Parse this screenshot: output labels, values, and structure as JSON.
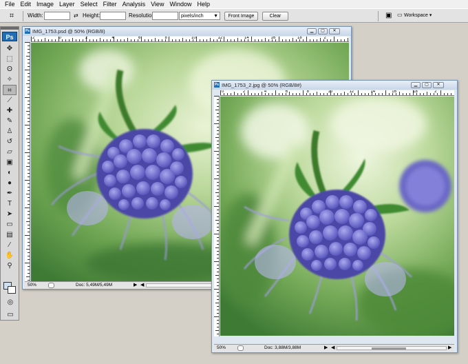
{
  "menu": [
    "File",
    "Edit",
    "Image",
    "Layer",
    "Select",
    "Filter",
    "Analysis",
    "View",
    "Window",
    "Help"
  ],
  "options_bar": {
    "width_label": "Width:",
    "height_label": "Height:",
    "resolution_label": "Resolution:",
    "units_value": "pixels/inch",
    "front_image_label": "Front Image",
    "clear_label": "Clear",
    "workspace_label": "Workspace"
  },
  "toolbox": {
    "logo": "Ps",
    "tools": [
      "move",
      "marquee",
      "lasso",
      "magic-wand",
      "crop",
      "eyedropper",
      "healing-brush",
      "brush",
      "clone-stamp",
      "history-brush",
      "eraser",
      "gradient",
      "blur",
      "dodge",
      "pen",
      "type",
      "path-selection",
      "rectangle",
      "notes",
      "eyedropper-2",
      "hand",
      "zoom"
    ],
    "active_tool": "crop",
    "foreground_color": "#cfe0f0",
    "background_color": "#ffffff"
  },
  "windows": [
    {
      "title": "IMG_1753.psd @ 50% (RGB/8)",
      "zoom": "50%",
      "doc_info": "Doc: 5,49M/5,49M",
      "ruler_numbers": [
        "2",
        "0",
        "2",
        "4",
        "6",
        "8",
        "10",
        "12",
        "14",
        "16",
        "18",
        "2"
      ]
    },
    {
      "title": "IMG_1753_2.jpg @ 50% (RGB/8#)",
      "zoom": "50%",
      "doc_info": "Doc: 3,88M/3,88M",
      "ruler_numbers": [
        "0",
        "2",
        "4",
        "6",
        "8",
        "10",
        "12",
        "14",
        "16",
        "18",
        "2"
      ]
    }
  ]
}
